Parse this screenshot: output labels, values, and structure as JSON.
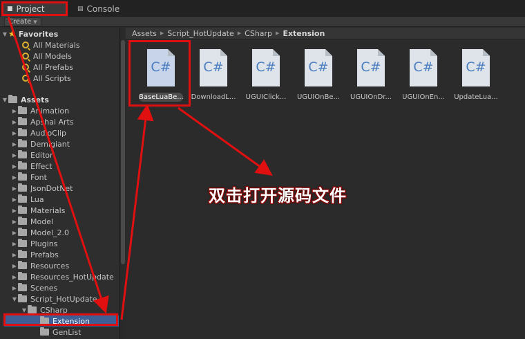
{
  "tabs": {
    "project": "Project",
    "console": "Console"
  },
  "toolbar": {
    "create_label": "Create"
  },
  "tree": {
    "favorites_header": "Favorites",
    "favorites": [
      "All Materials",
      "All Models",
      "All Prefabs",
      "All Scripts"
    ],
    "assets_header": "Assets",
    "folders": [
      "Animation",
      "Apshai Arts",
      "AudioClip",
      "Demigiant",
      "Editor",
      "Effect",
      "Font",
      "JsonDotNet",
      "Lua",
      "Materials",
      "Model",
      "Model_2.0",
      "Plugins",
      "Prefabs",
      "Resources",
      "Resources_HotUpdate",
      "Scenes",
      "Script_HotUpdate"
    ],
    "csharp": "CSharp",
    "extension": "Extension",
    "genlist": "GenList"
  },
  "breadcrumb": [
    "Assets",
    "Script_HotUpdate",
    "CSharp",
    "Extension"
  ],
  "files": [
    {
      "icon_label": "C#",
      "name": "BaseLuaBe..."
    },
    {
      "icon_label": "C#",
      "name": "DownloadL..."
    },
    {
      "icon_label": "C#",
      "name": "UGUIClick..."
    },
    {
      "icon_label": "C#",
      "name": "UGUIOnBe..."
    },
    {
      "icon_label": "C#",
      "name": "UGUIOnDr..."
    },
    {
      "icon_label": "C#",
      "name": "UGUIOnEn..."
    },
    {
      "icon_label": "C#",
      "name": "UpdateLua..."
    }
  ],
  "annotation": {
    "text": "双击打开源码文件",
    "color": "#e01010"
  }
}
